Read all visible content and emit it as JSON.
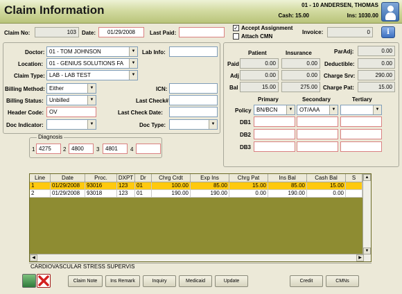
{
  "header": {
    "title": "Claim Information",
    "patient": "01 - 10 ANDERSEN, THOMAS",
    "cash": "Cash: 15.00",
    "ins": "Ins: 1030.00"
  },
  "claim": {
    "claim_no_label": "Claim No:",
    "claim_no": "103",
    "date_label": "Date:",
    "date": "01/29/2008",
    "last_paid_label": "Last Paid:",
    "last_paid": "",
    "accept_assignment_label": "Accept Assignment",
    "accept_assignment_mark": "✓",
    "attach_cmn_label": "Attach CMN",
    "invoice_label": "Invoice:",
    "invoice": "0",
    "info_button": "i"
  },
  "left": {
    "doctor_label": "Doctor:",
    "doctor": "01 - TOM JOHNSON",
    "lab_info_label": "Lab Info:",
    "lab_info": "",
    "location_label": "Location:",
    "location": "01 - GENIUS SOLUTIONS FA",
    "claim_type_label": "Claim Type:",
    "claim_type": "LAB - LAB TEST",
    "billing_method_label": "Billing Method:",
    "billing_method": "Either",
    "icn_label": "ICN:",
    "icn": "",
    "billing_status_label": "Billing Status:",
    "billing_status": "Unbilled",
    "last_check_no_label": "Last Check#:",
    "last_check_no": "",
    "header_code_label": "Header Code:",
    "header_code": "OV",
    "last_check_date_label": "Last Check Date:",
    "last_check_date": "",
    "doc_indicator_label": "Doc Indicator:",
    "doc_indicator": "",
    "doc_type_label": "Doc Type:",
    "doc_type": ""
  },
  "diagnosis": {
    "label": "Diagnosis",
    "n1": "1",
    "d1": "4275",
    "n2": "2",
    "d2": "4800",
    "n3": "3",
    "d3": "4801",
    "n4": "4",
    "d4": ""
  },
  "balances": {
    "patient_header": "Patient",
    "insurance_header": "Insurance",
    "paid_label": "Paid",
    "adj_label": "Adj",
    "bal_label": "Bal",
    "patient_paid": "0.00",
    "patient_adj": "0.00",
    "patient_bal": "15.00",
    "ins_paid": "0.00",
    "ins_adj": "0.00",
    "ins_bal": "275.00",
    "par_adj_label": "ParAdj:",
    "par_adj": "0.00",
    "deductible_label": "Deductible:",
    "deductible": "0.00",
    "charge_srv_label": "Charge Srv:",
    "charge_srv": "290.00",
    "charge_pat_label": "Charge Pat:",
    "charge_pat": "15.00"
  },
  "policy": {
    "primary_header": "Primary",
    "secondary_header": "Secondary",
    "tertiary_header": "Tertiary",
    "policy_label": "Policy",
    "primary": "BN/BCN",
    "secondary": "OT/AAA",
    "tertiary": "",
    "db1_label": "DB1",
    "db2_label": "DB2",
    "db3_label": "DB3"
  },
  "table": {
    "columns": [
      "Line",
      "Date",
      "Proc.",
      "DXPT",
      "Dr",
      "Chrg Crdt",
      "Exp Ins",
      "Chrg Pat",
      "Ins Bal",
      "Cash Bal",
      "S"
    ],
    "rows": [
      [
        "1",
        "01/29/2008",
        "93016",
        "123",
        "01",
        "100.00",
        "85.00",
        "15.00",
        "85.00",
        "15.00",
        ""
      ],
      [
        "2",
        "01/29/2008",
        "93018",
        "123",
        "01",
        "190.00",
        "190.00",
        "0.00",
        "190.00",
        "0.00",
        ""
      ]
    ],
    "description": "CARDIOVASCULAR STRESS SUPERVIS"
  },
  "buttons": {
    "claim_note": "Claim Note",
    "ins_remark": "Ins Remark",
    "inquiry": "Inquiry",
    "medicaid": "Medicaid",
    "update": "Update",
    "credit": "Credit",
    "cmns": "CMNs"
  },
  "colors": {
    "selected_row": "#ffc90e",
    "grid_background": "#8e8c32",
    "header_gradient": "#c8d08a",
    "close_red": "#d42020"
  }
}
